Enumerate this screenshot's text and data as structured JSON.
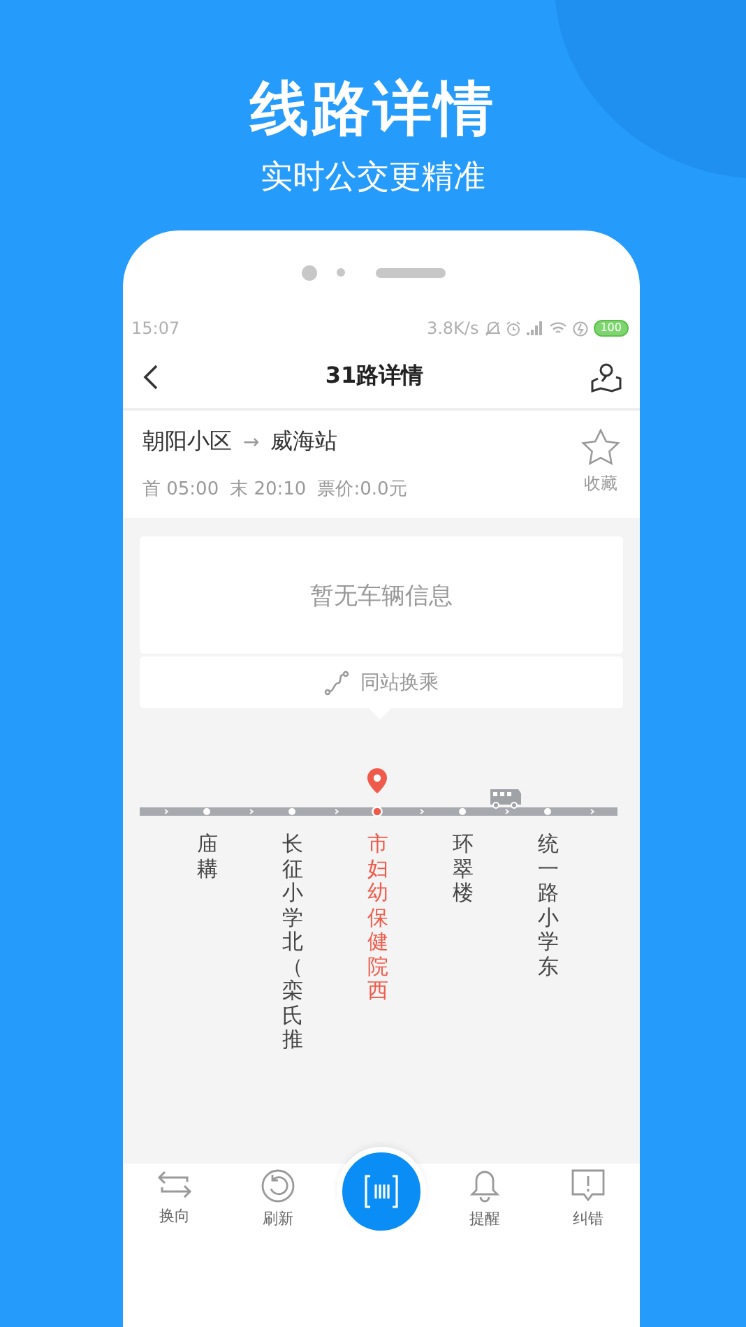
{
  "header": {
    "title": "线路详情",
    "subtitle": "实时公交更精准"
  },
  "status_bar": {
    "time": "15:07",
    "speed": "3.8K/s",
    "battery": "100"
  },
  "nav": {
    "title": "31路详情"
  },
  "route": {
    "from": "朝阳小区",
    "arrow": "→",
    "to": "威海站",
    "first": "首 05:00",
    "last": "末 20:10",
    "fare": "票价:0.0元",
    "favorite": {
      "label": "收藏",
      "selected": false
    }
  },
  "vehicle_info": "暂无车辆信息",
  "transfer": "同站换乘",
  "stops": [
    {
      "name": "庙耩",
      "selected": false,
      "bus_ahead": false
    },
    {
      "name": "长征小学北（栾氏推",
      "selected": false,
      "bus_ahead": false
    },
    {
      "name": "市妇幼保健院西",
      "selected": true,
      "bus_ahead": false
    },
    {
      "name": "环翠楼",
      "selected": false,
      "bus_ahead": true
    },
    {
      "name": "统一路小学东",
      "selected": false,
      "bus_ahead": false
    }
  ],
  "toolbar": [
    {
      "kind": "swap",
      "label": "换向"
    },
    {
      "kind": "refresh",
      "label": "刷新"
    },
    {
      "kind": "scan"
    },
    {
      "kind": "bell",
      "label": "提醒"
    },
    {
      "kind": "report",
      "label": "纠错"
    }
  ]
}
